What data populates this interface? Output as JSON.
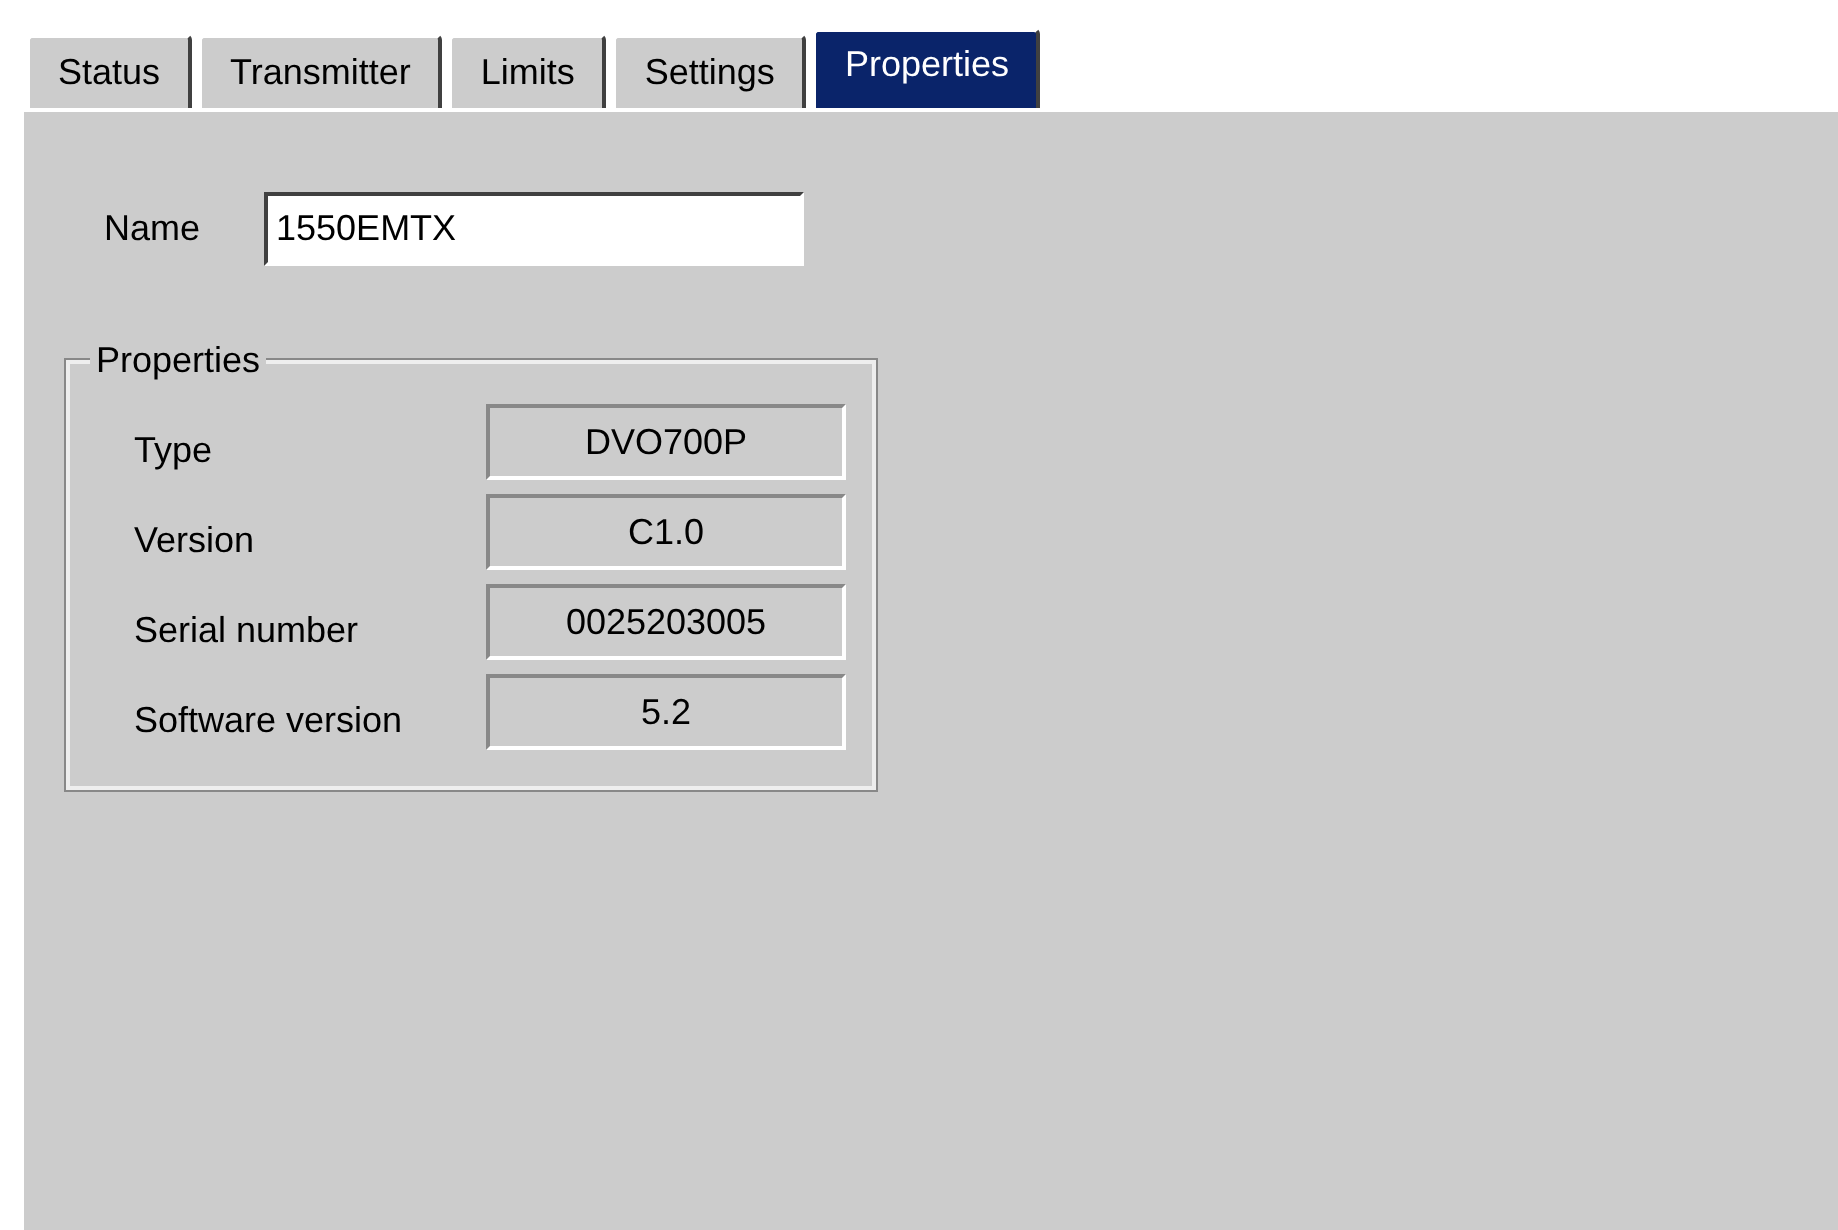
{
  "tabs": [
    {
      "label": "Status",
      "selected": false
    },
    {
      "label": "Transmitter",
      "selected": false
    },
    {
      "label": "Limits",
      "selected": false
    },
    {
      "label": "Settings",
      "selected": false
    },
    {
      "label": "Properties",
      "selected": true
    }
  ],
  "name_field": {
    "label": "Name",
    "value": "1550EMTX"
  },
  "properties_group": {
    "title": "Properties",
    "rows": [
      {
        "label": "Type",
        "value": "DVO700P"
      },
      {
        "label": "Version",
        "value": "C1.0"
      },
      {
        "label": "Serial number",
        "value": "0025203005"
      },
      {
        "label": "Software version",
        "value": "5.2"
      }
    ]
  }
}
